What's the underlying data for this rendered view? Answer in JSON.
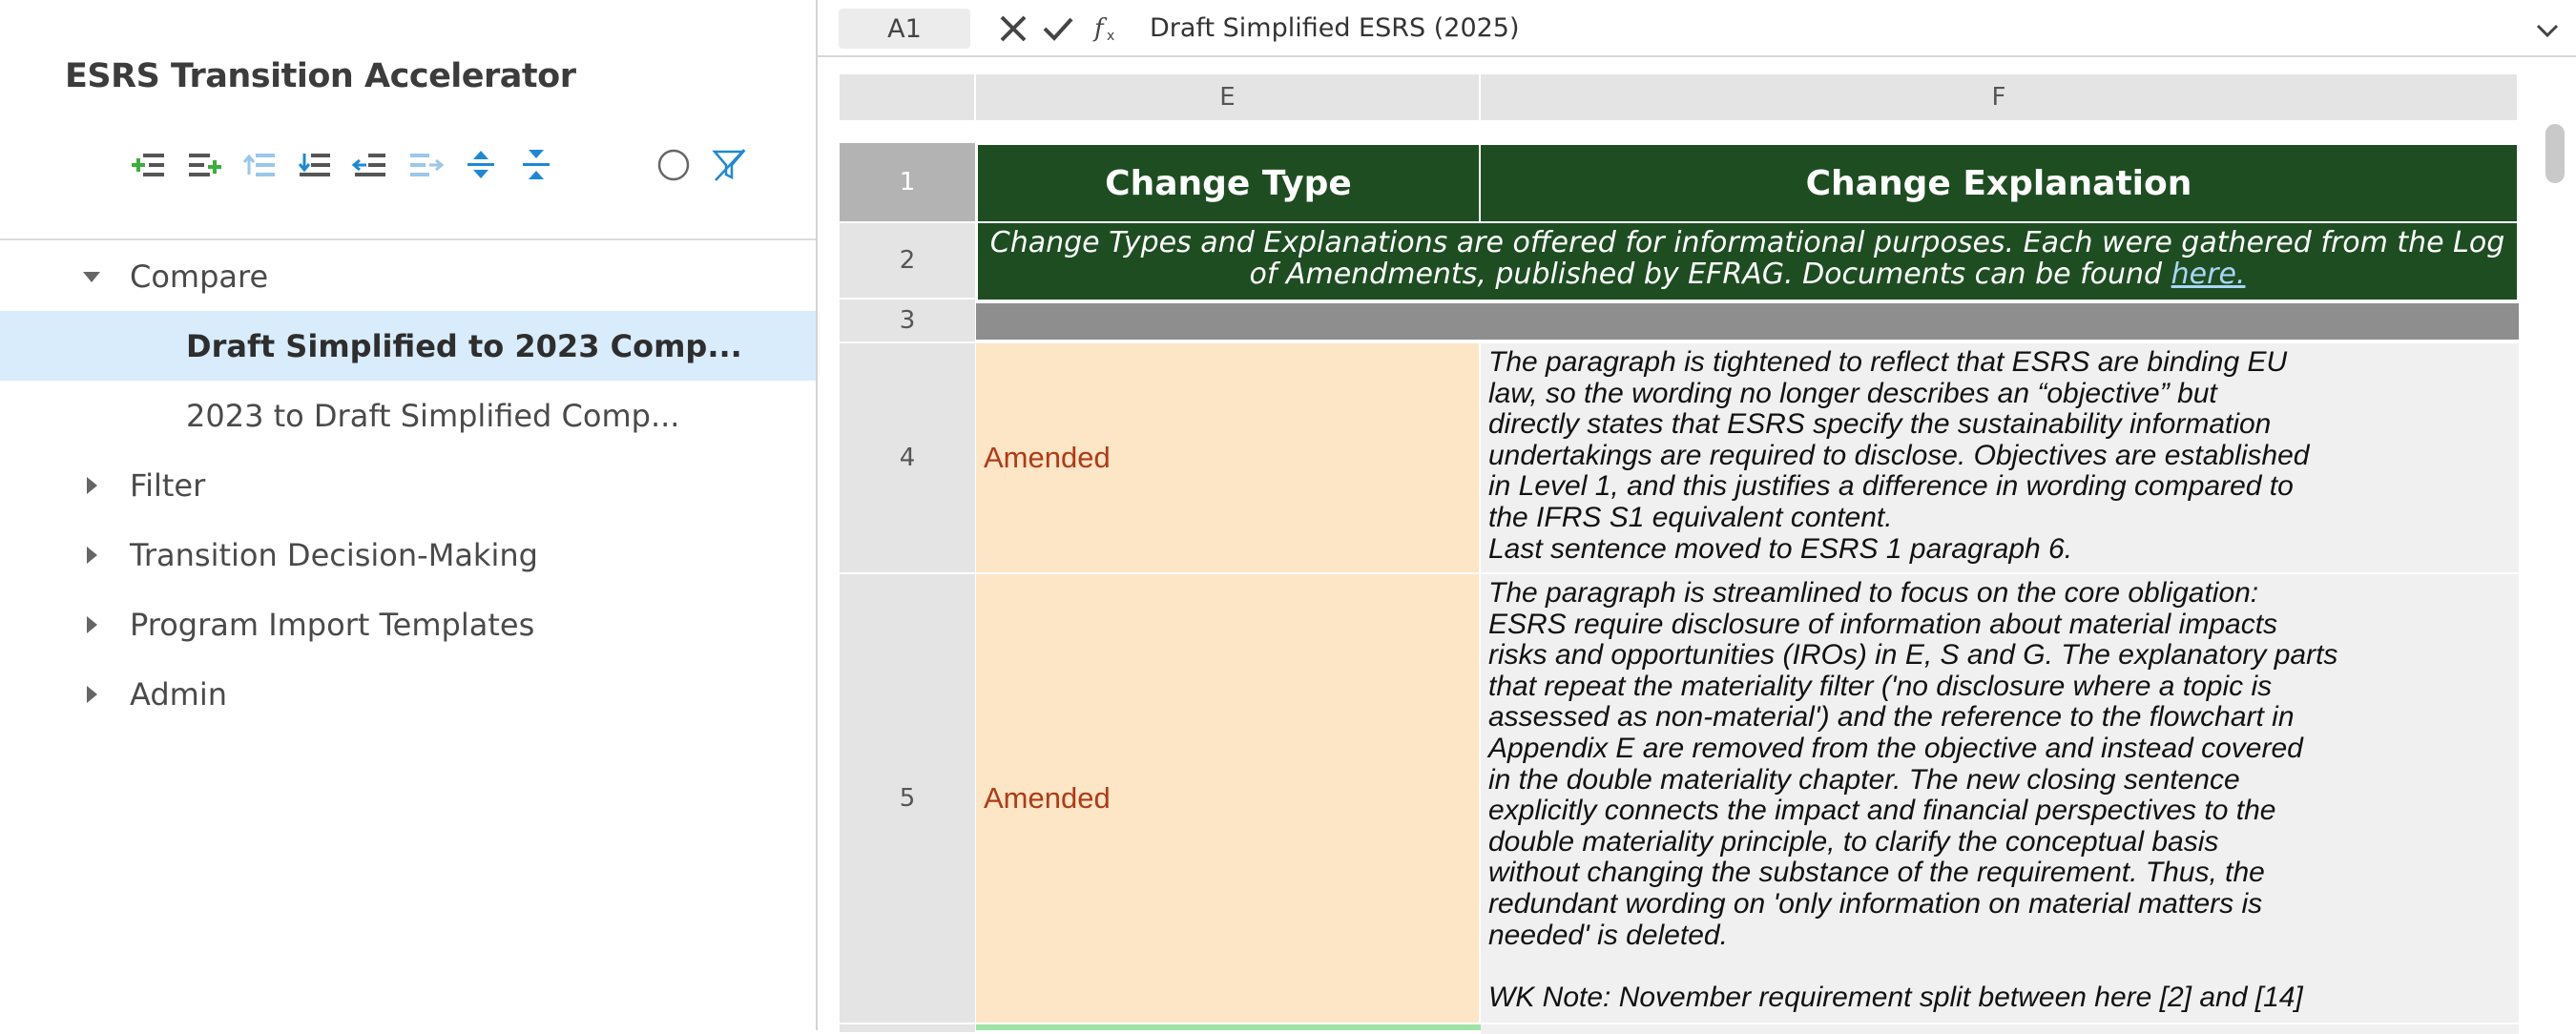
{
  "sidebar": {
    "app_title": "ESRS Transition Accelerator",
    "toolbar_icons": [
      "add-row-icon",
      "add-row-after-icon",
      "indent-up-icon",
      "insert-below-icon",
      "outdent-icon",
      "indent-icon",
      "expand-all-icon",
      "collapse-all-icon",
      "circle-icon",
      "filter-off-icon"
    ],
    "tree": {
      "compare": "Compare",
      "draft_to_2023": "Draft Simplified to 2023 Comp...",
      "y2023_to_draft": "2023 to Draft Simplified Comp...",
      "filter": "Filter",
      "transition": "Transition Decision-Making",
      "program_import": "Program Import Templates",
      "admin": "Admin"
    }
  },
  "formula_bar": {
    "cell_ref": "A1",
    "formula": "Draft Simplified ESRS (2025)"
  },
  "grid": {
    "columns": [
      "E",
      "F"
    ],
    "rows": [
      "1",
      "2",
      "3",
      "4",
      "5"
    ],
    "header_row": {
      "change_type": "Change Type",
      "change_explanation": "Change Explanation"
    },
    "note_row": {
      "text": "Change Types and Explanations are offered for informational purposes. Each were gathered from the Log of Amendments, published by EFRAG. Documents can be found",
      "link": "here."
    },
    "data_rows": [
      {
        "type": "Amended",
        "explanation": "The paragraph is tightened to reflect that ESRS are binding EU\nlaw, so the wording no longer describes an “objective” but\ndirectly states that ESRS specify the sustainability information\nundertakings are required to disclose. Objectives are established\nin Level 1, and this justifies a difference in wording compared to\nthe IFRS S1 equivalent content.\nLast sentence moved to ESRS 1 paragraph 6."
      },
      {
        "type": "Amended",
        "explanation": "The paragraph is streamlined to focus on the core obligation:\nESRS require disclosure of information about material impacts\nrisks and opportunities (IROs) in E, S and G. The explanatory parts\nthat repeat the materiality filter ('no disclosure where a topic is\nassessed as non-material') and the reference to the flowchart in\nAppendix E are removed from the objective and instead covered\nin the double materiality chapter. The new closing sentence\nexplicitly connects the impact and financial perspectives to the\ndouble materiality principle, to clarify the conceptual basis\nwithout changing the substance of the requirement. Thus, the\nredundant wording on 'only information on material matters is\nneeded' is deleted.\n\nWK Note: November requirement split between here [2] and [14]"
      }
    ]
  },
  "colors": {
    "header_green": "#1e4d22",
    "amended_bg": "#fde6c6",
    "amended_text": "#b03a16",
    "selected_tree_bg": "#d8ecfb",
    "toolbar_green": "#3cae3c",
    "toolbar_blue": "#1e88d6"
  }
}
